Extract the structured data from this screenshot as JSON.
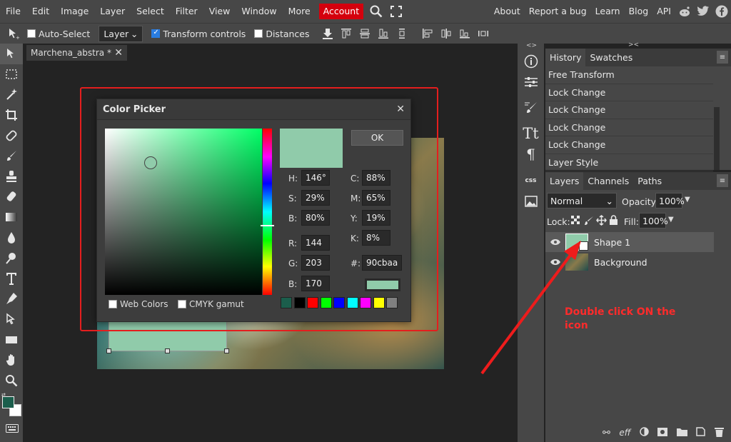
{
  "menubar": {
    "items": [
      "File",
      "Edit",
      "Image",
      "Layer",
      "Select",
      "Filter",
      "View",
      "Window",
      "More"
    ],
    "account_label": "Account",
    "right_links": [
      "About",
      "Report a bug",
      "Learn",
      "Blog",
      "API"
    ],
    "icons": [
      "search-icon",
      "fullscreen-icon",
      "reddit-icon",
      "twitter-icon",
      "facebook-icon"
    ]
  },
  "optionsbar": {
    "auto_select_label": "Auto-Select",
    "auto_select_checked": false,
    "layer_select_value": "Layer",
    "transform_controls_label": "Transform controls",
    "transform_controls_checked": true,
    "distances_label": "Distances",
    "distances_checked": false
  },
  "document": {
    "tab_title": "Marchena_abstra",
    "tab_modified": "*"
  },
  "color_picker": {
    "title": "Color Picker",
    "ok_label": "OK",
    "preview_color": "#90cbaa",
    "fields": {
      "h_label": "H:",
      "h_value": "146°",
      "s_label": "S:",
      "s_value": "29%",
      "b_label": "B:",
      "b_value": "80%",
      "r_label": "R:",
      "r_value": "144",
      "g_label": "G:",
      "g_value": "203",
      "b2_label": "B:",
      "b2_value": "170",
      "c_label": "C:",
      "c_value": "88%",
      "m_label": "M:",
      "m_value": "65%",
      "y_label": "Y:",
      "y_value": "19%",
      "k_label": "K:",
      "k_value": "8%",
      "hex_label": "#:",
      "hex_value": "90cbaa"
    },
    "web_colors_label": "Web Colors",
    "cmyk_gamut_label": "CMYK gamut",
    "palette": [
      "#1b5e4c",
      "#000000",
      "#ff0000",
      "#00ff00",
      "#0000ff",
      "#00ffff",
      "#ff00ff",
      "#ffff00",
      "#808080"
    ]
  },
  "history": {
    "tabs": [
      "History",
      "Swatches"
    ],
    "items": [
      "Free Transform",
      "Lock Change",
      "Lock Change",
      "Lock Change",
      "Lock Change",
      "Layer Style"
    ]
  },
  "layers": {
    "tabs": [
      "Layers",
      "Channels",
      "Paths"
    ],
    "blend_mode": "Normal",
    "opacity_label": "Opacity:",
    "opacity_value": "100%",
    "lock_label": "Lock:",
    "fill_label": "Fill:",
    "fill_value": "100%",
    "items": [
      {
        "name": "Shape 1",
        "selected": true
      },
      {
        "name": "Background",
        "selected": false
      }
    ]
  },
  "side_strip": {
    "css_label": "css",
    "collapse_left": "<>",
    "collapse_right": "><"
  },
  "annotation": {
    "text": "Double click ON the icon"
  },
  "colors": {
    "accent_red": "#d4000d",
    "foreground": "#1b5e4c",
    "picked": "#90cbaa"
  }
}
